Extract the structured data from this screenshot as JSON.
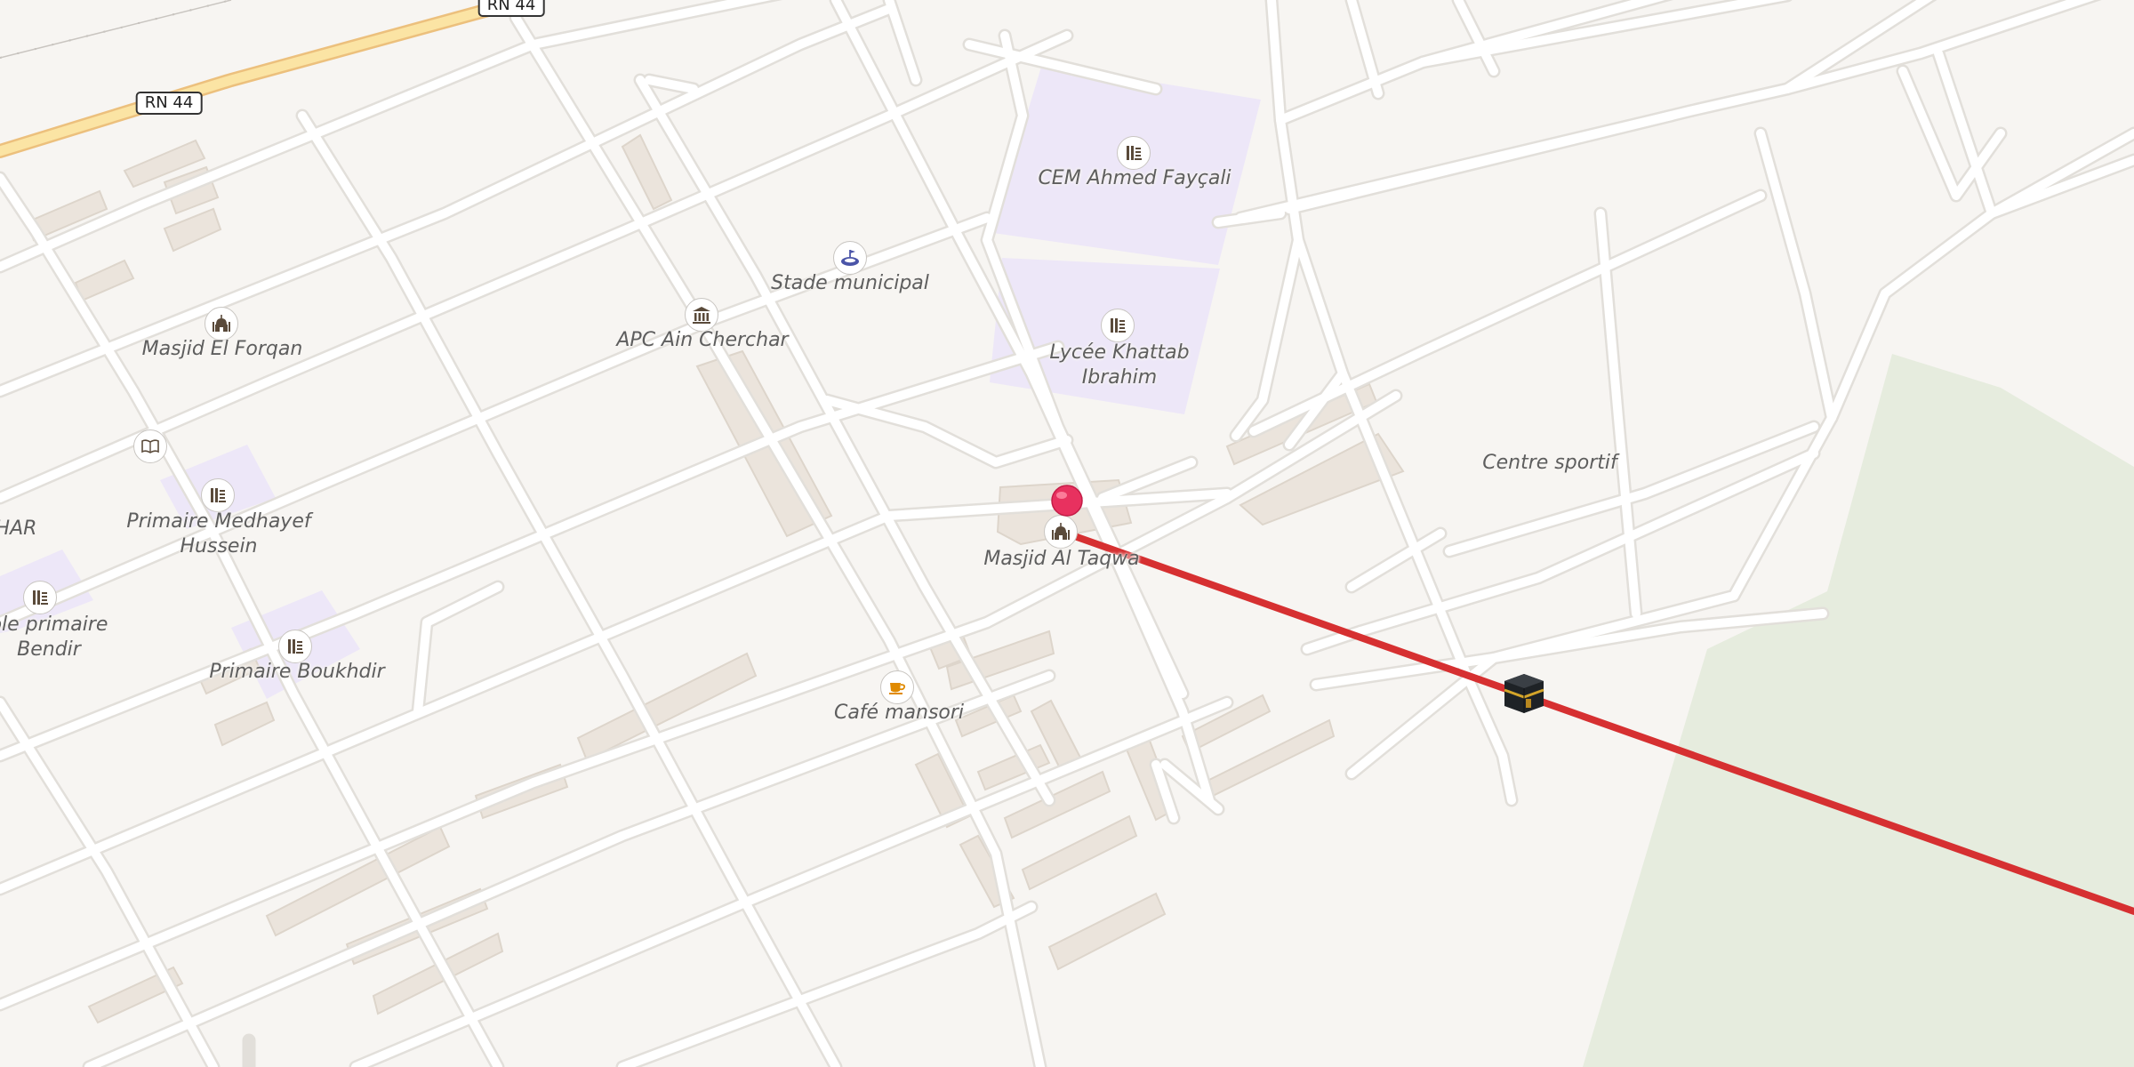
{
  "map": {
    "road_badges": [
      {
        "id": "rn44-top",
        "label": "RN 44"
      },
      {
        "id": "rn44-left",
        "label": "RN 44"
      }
    ],
    "pois": [
      {
        "id": "cem-ahmed-faycali",
        "lines": [
          "CEM Ahmed Fayçali"
        ],
        "icon": "school-icon"
      },
      {
        "id": "stade-municipal",
        "lines": [
          "Stade municipal"
        ],
        "icon": "stadium-icon"
      },
      {
        "id": "apc-ain-cherchar",
        "lines": [
          "APC Ain Cherchar"
        ],
        "icon": "town-hall-icon"
      },
      {
        "id": "masjid-el-forqan",
        "lines": [
          "Masjid El Forqan"
        ],
        "icon": "mosque-icon"
      },
      {
        "id": "lycee-khattab-ibrahim",
        "lines": [
          "Lycée Khattab",
          "Ibrahim"
        ],
        "icon": "school-icon"
      },
      {
        "id": "centre-sportif",
        "lines": [
          "Centre sportif"
        ],
        "icon": ""
      },
      {
        "id": "masjid-al-taqwa",
        "lines": [
          "Masjid Al Taqwa"
        ],
        "icon": "mosque-icon"
      },
      {
        "id": "primaire-medhayef-hussein",
        "lines": [
          "Primaire Medhayef",
          "Hussein"
        ],
        "icon": "school-icon"
      },
      {
        "id": "har-partial",
        "lines": [
          "HAR"
        ],
        "icon": ""
      },
      {
        "id": "ecole-primaire-bendir",
        "lines": [
          "ole primaire",
          "Bendir"
        ],
        "icon": "school-icon"
      },
      {
        "id": "primaire-boukhdir",
        "lines": [
          "Primaire Boukhdir"
        ],
        "icon": "school-icon"
      },
      {
        "id": "cafe-mansori",
        "lines": [
          "Café mansori"
        ],
        "icon": "cafe-icon"
      },
      {
        "id": "library",
        "lines": [],
        "icon": "book-icon"
      }
    ],
    "selected_location": {
      "icon": "map-pin-icon",
      "color": "#e8315f"
    },
    "qibla_direction": {
      "icon": "kaaba-icon",
      "line_color": "#d63031"
    },
    "colors": {
      "background": "#f7f5f2",
      "road": "#ffffff",
      "road_casing": "#e2dfda",
      "highway": "#fbe4a4",
      "highway_casing": "#ecc07d",
      "building": "#ebe4dc",
      "school_area": "#ede7f8",
      "park": "#e6ecde"
    }
  }
}
